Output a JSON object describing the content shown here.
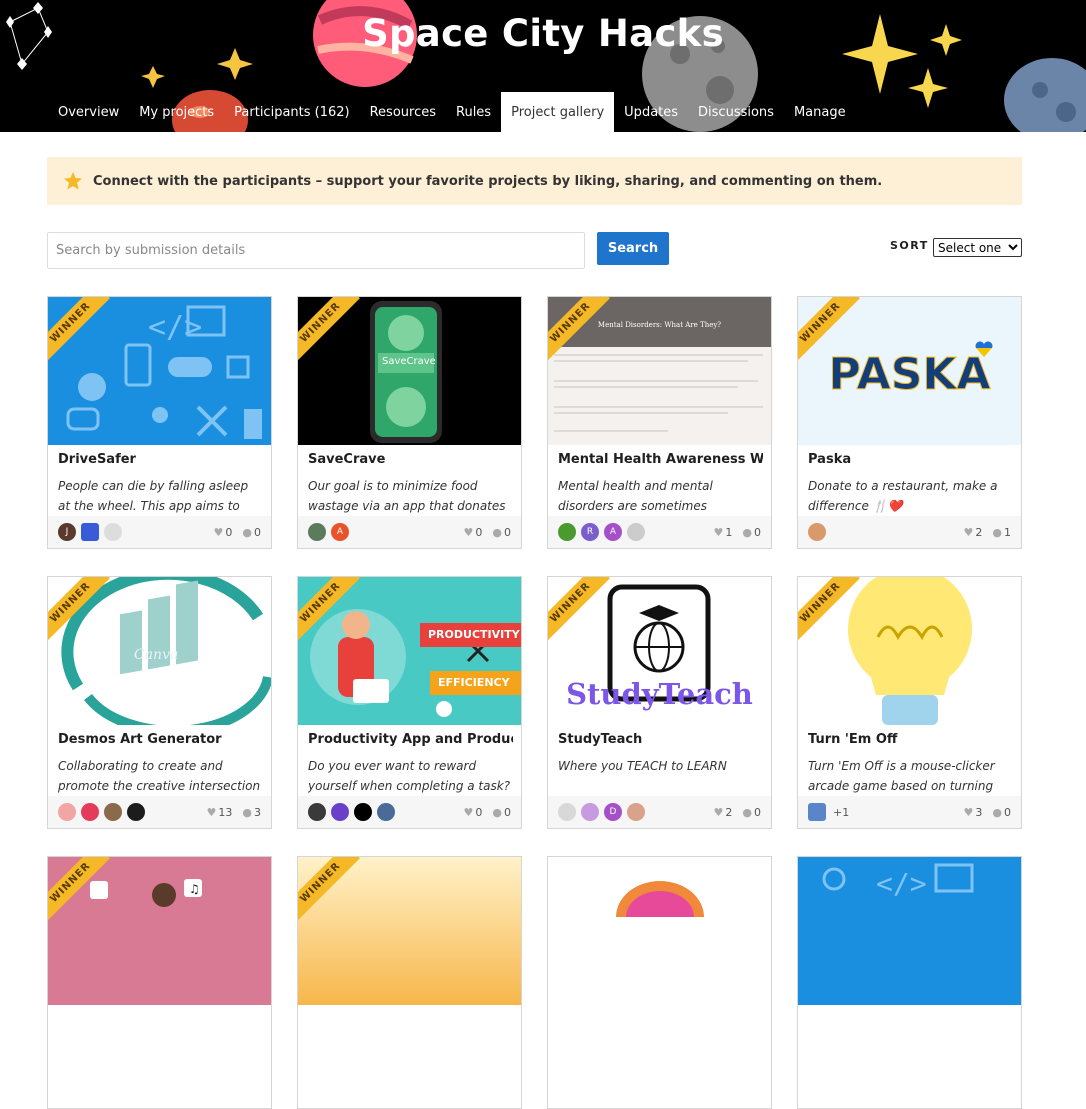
{
  "header": {
    "title": "Space City Hacks"
  },
  "nav": {
    "tabs": [
      {
        "label": "Overview"
      },
      {
        "label": "My projects"
      },
      {
        "label": "Participants (162)"
      },
      {
        "label": "Resources"
      },
      {
        "label": "Rules"
      },
      {
        "label": "Project gallery",
        "active": true
      },
      {
        "label": "Updates"
      },
      {
        "label": "Discussions"
      },
      {
        "label": "Manage"
      }
    ]
  },
  "banner": {
    "text": "Connect with the participants – support your favorite projects by liking, sharing, and commenting on them."
  },
  "search": {
    "placeholder": "Search by submission details",
    "button_label": "Search"
  },
  "sort": {
    "label": "SORT",
    "selected": "Select one"
  },
  "ribbon_label": "WINNER",
  "projects": [
    {
      "title": "DriveSafer",
      "desc": "People can die by falling asleep at the wheel. This app aims to prevent",
      "likes": "0",
      "comments": "0",
      "avatars": [
        "J"
      ],
      "image_text": ""
    },
    {
      "title": "SaveCrave",
      "desc": "Our goal is to minimize food wastage via an app that donates food to",
      "likes": "0",
      "comments": "0",
      "avatars": [
        "A"
      ],
      "image_text": "SaveCrave"
    },
    {
      "title": "Mental Health Awareness Webs",
      "desc": "Mental health and mental disorders are sometimes misunderstood by the",
      "likes": "1",
      "comments": "0",
      "avatars": [
        "R",
        "A"
      ],
      "image_text": "Mental Disorders: What Are They?"
    },
    {
      "title": "Paska",
      "desc": "Donate to a restaurant, make a difference 🍴❤️",
      "likes": "2",
      "comments": "1",
      "avatars": [],
      "image_text": "PASKA"
    },
    {
      "title": "Desmos Art Generator",
      "desc": "Collaborating to create and promote the creative intersection of",
      "likes": "13",
      "comments": "3",
      "avatars": [],
      "image_text": "Canva"
    },
    {
      "title": "Productivity App and Productiv",
      "desc": "Do you ever want to reward yourself when completing a task? This app",
      "likes": "0",
      "comments": "0",
      "avatars": [],
      "image_text": "PRODUCTIVITY"
    },
    {
      "title": "StudyTeach",
      "desc": "Where you TEACH to LEARN",
      "likes": "2",
      "comments": "0",
      "avatars": [
        "D"
      ],
      "image_text": "StudyTeach"
    },
    {
      "title": "Turn 'Em Off",
      "desc": "Turn 'Em Off is a mouse-clicker arcade game based on turning",
      "likes": "3",
      "comments": "0",
      "avatars": [],
      "more": "+1",
      "image_text": ""
    }
  ],
  "image_extra": {
    "efficiency": "EFFICIENCY"
  },
  "colors": {
    "accent": "#1f74cc",
    "banner_bg": "#fdf0d7",
    "ribbon": "#f5b826"
  }
}
